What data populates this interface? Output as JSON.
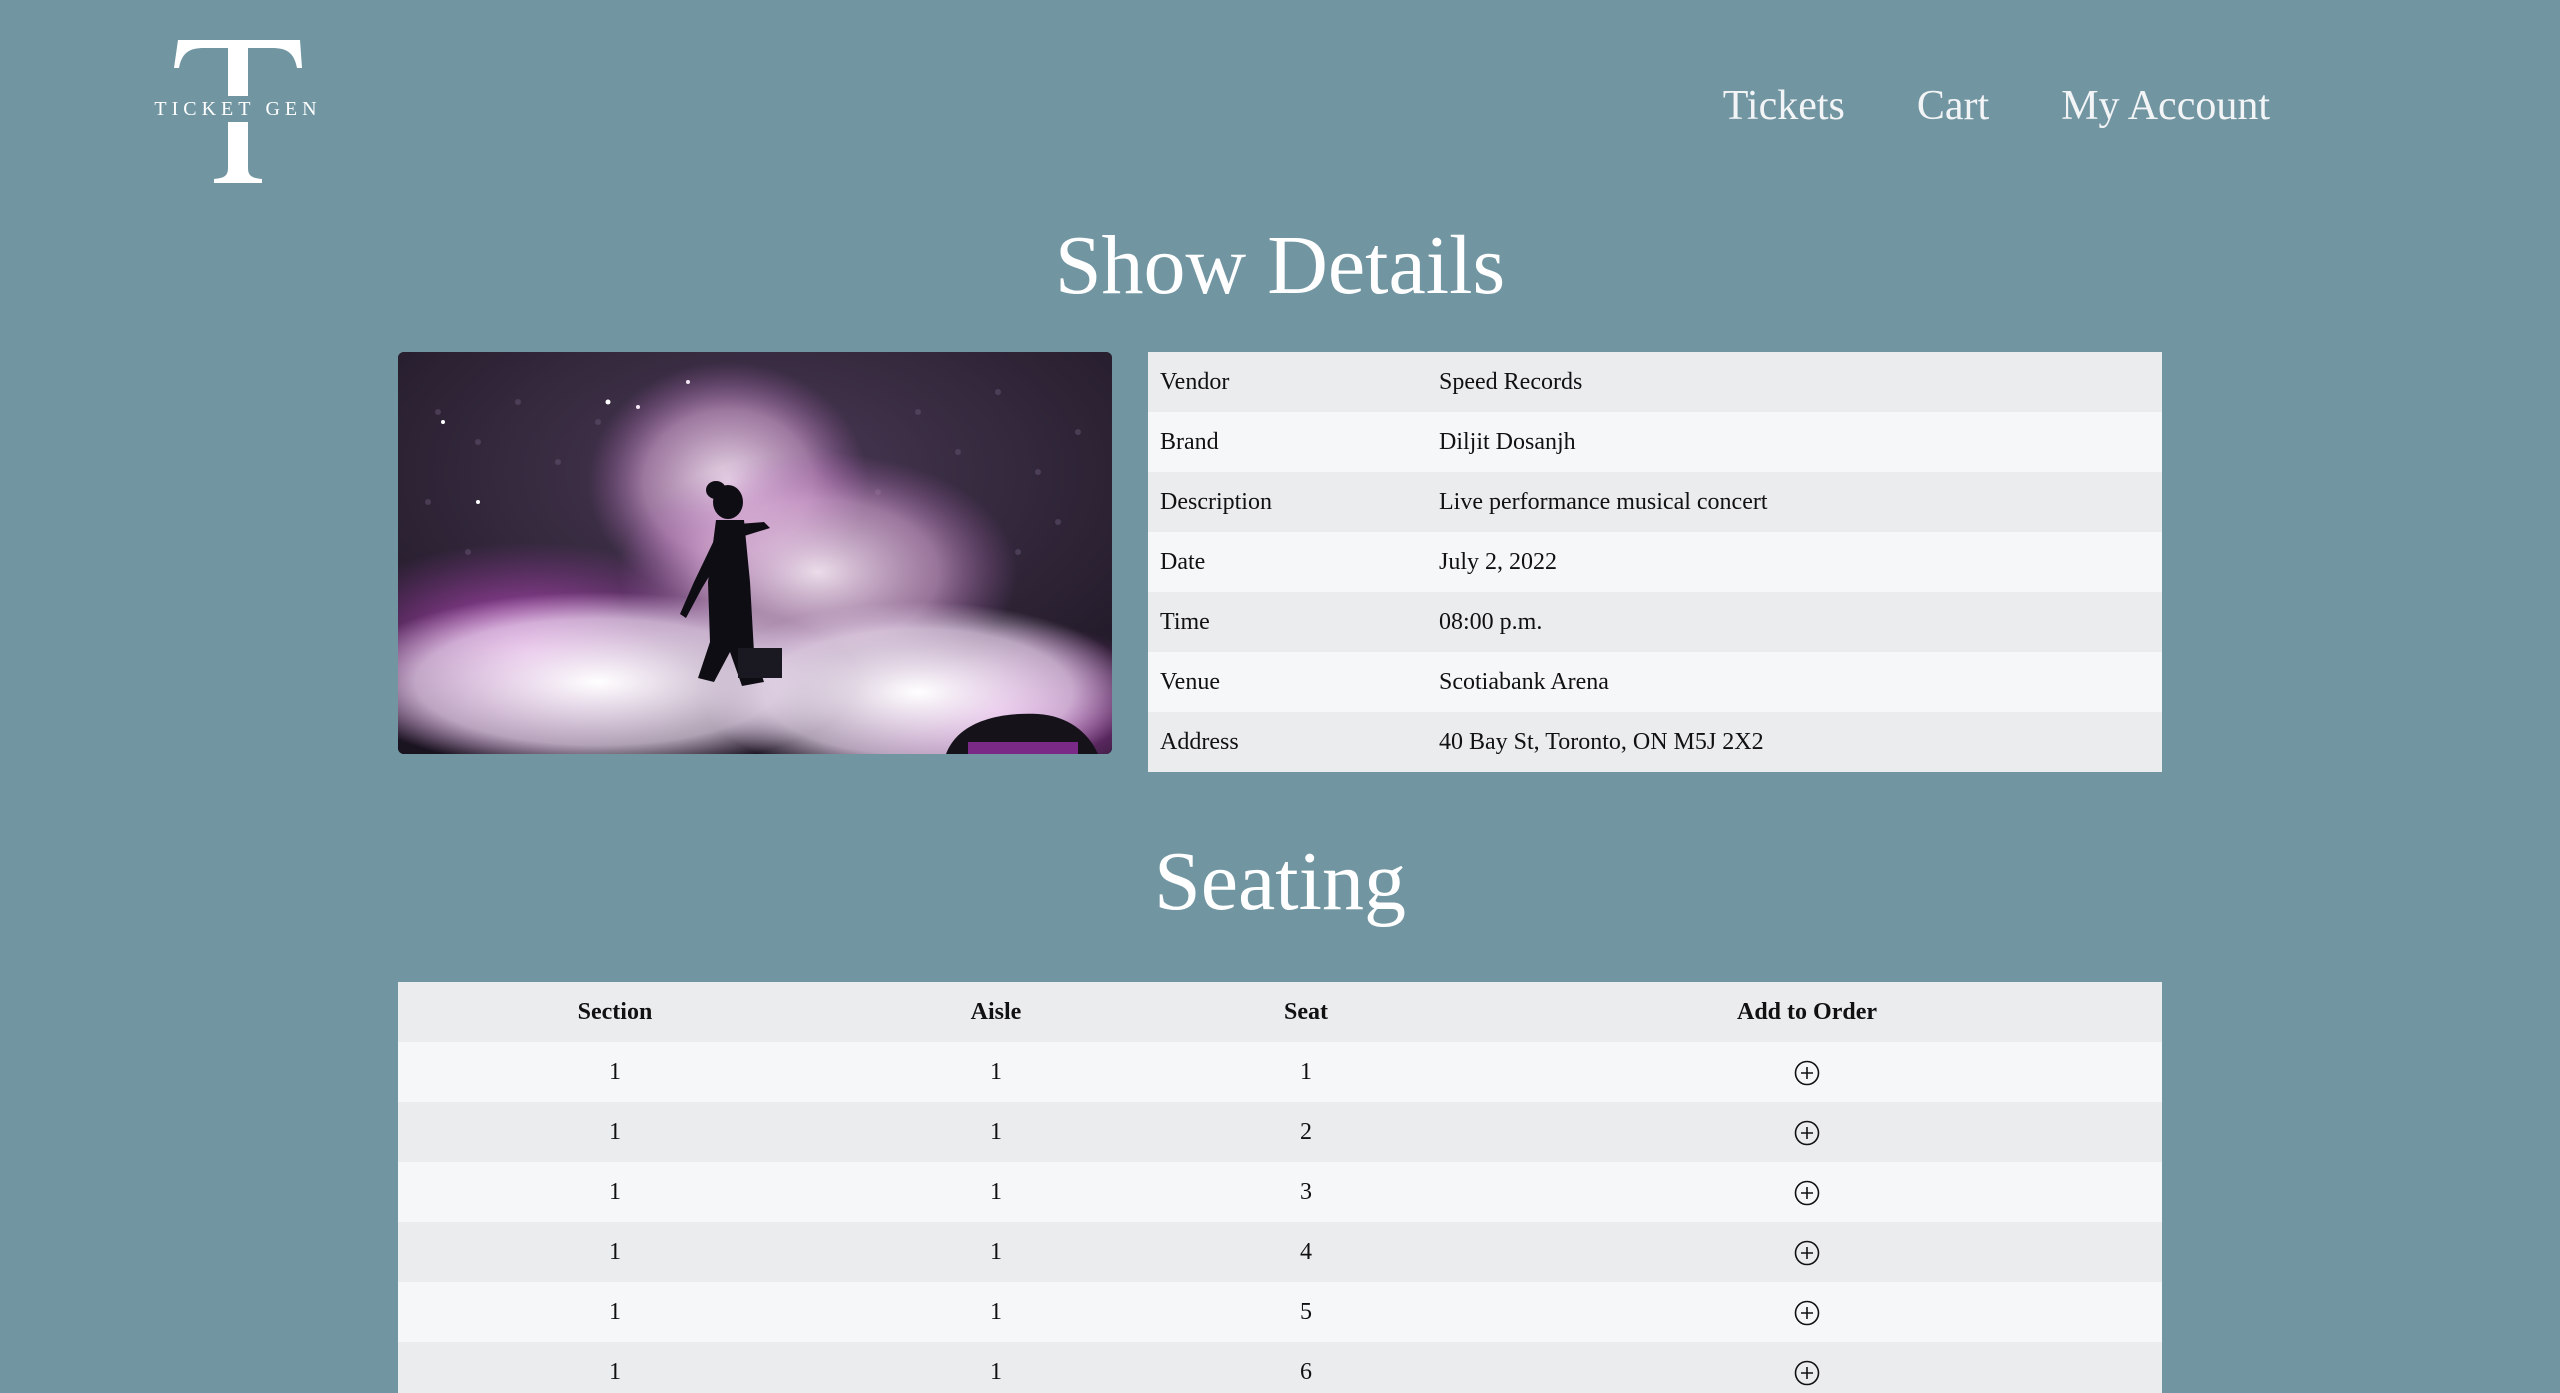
{
  "brand": {
    "logo_letter": "T",
    "logo_text_left": "TICKET",
    "logo_text_right": "GEN"
  },
  "nav": {
    "items": [
      {
        "label": "Tickets"
      },
      {
        "label": "Cart"
      },
      {
        "label": "My Account"
      }
    ]
  },
  "show": {
    "title": "Show Details",
    "image_icon": "concert-photo",
    "details": [
      {
        "key": "Vendor",
        "value": "Speed Records"
      },
      {
        "key": "Brand",
        "value": "Diljit Dosanjh"
      },
      {
        "key": "Description",
        "value": "Live performance musical concert"
      },
      {
        "key": "Date",
        "value": "July 2, 2022"
      },
      {
        "key": "Time",
        "value": "08:00 p.m."
      },
      {
        "key": "Venue",
        "value": "Scotiabank Arena"
      },
      {
        "key": "Address",
        "value": "40 Bay St, Toronto, ON M5J 2X2"
      }
    ]
  },
  "seating": {
    "title": "Seating",
    "columns": [
      "Section",
      "Aisle",
      "Seat",
      "Add to Order"
    ],
    "add_icon": "plus-circle-icon",
    "rows": [
      {
        "section": "1",
        "aisle": "1",
        "seat": "1"
      },
      {
        "section": "1",
        "aisle": "1",
        "seat": "2"
      },
      {
        "section": "1",
        "aisle": "1",
        "seat": "3"
      },
      {
        "section": "1",
        "aisle": "1",
        "seat": "4"
      },
      {
        "section": "1",
        "aisle": "1",
        "seat": "5"
      },
      {
        "section": "1",
        "aisle": "1",
        "seat": "6"
      }
    ]
  },
  "colors": {
    "background": "#7196a2",
    "row_light": "#f6f7f9",
    "row_dark": "#ebecee",
    "heading": "#ffffff"
  }
}
